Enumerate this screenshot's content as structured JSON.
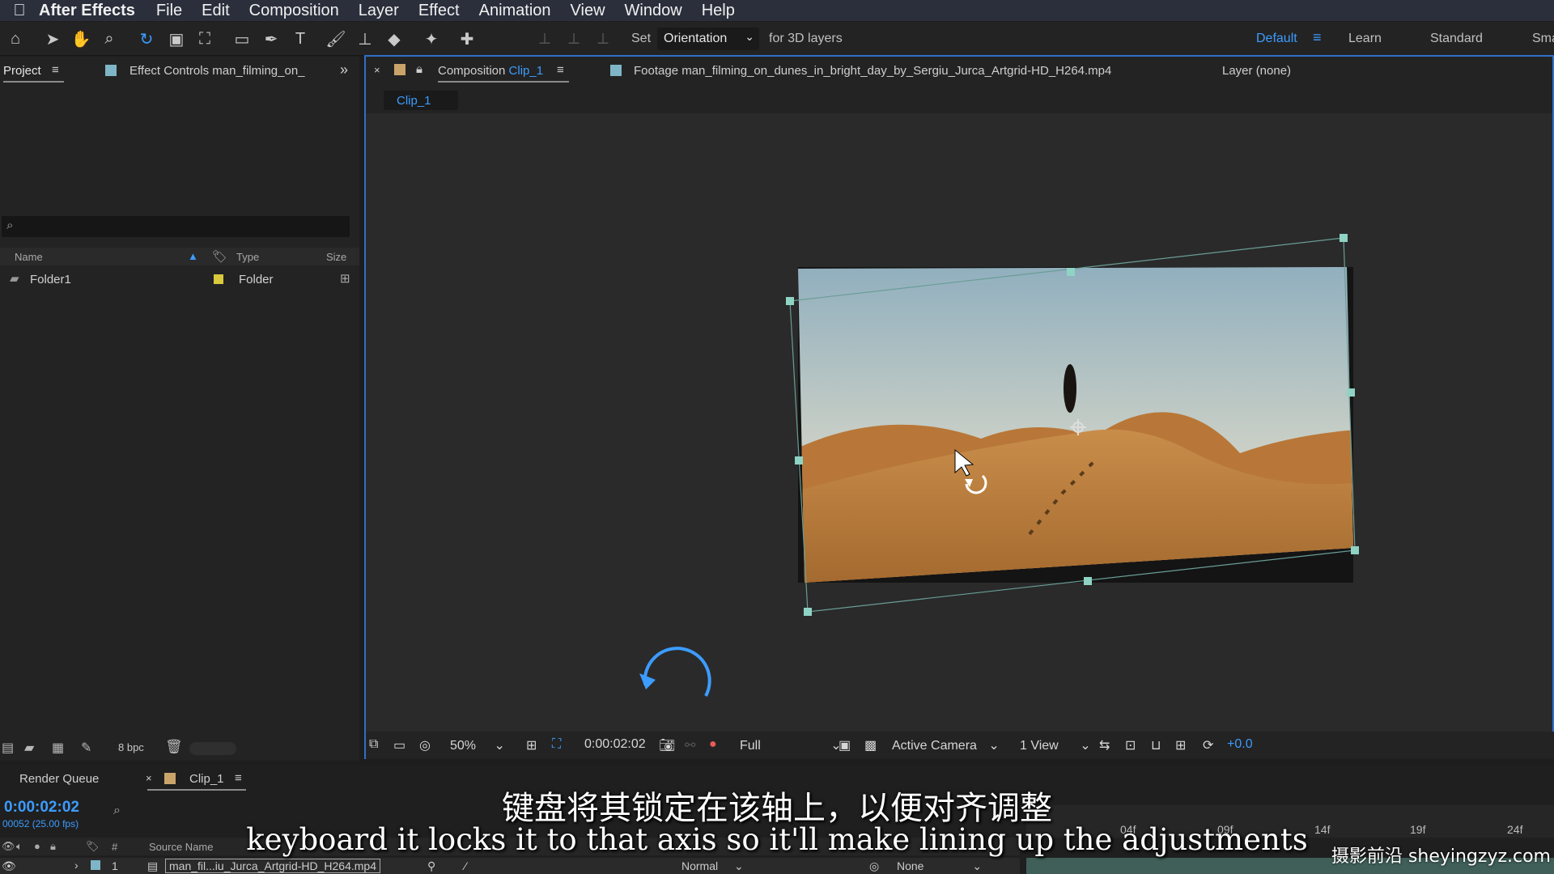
{
  "menubar": {
    "app_name": "After Effects",
    "items": [
      "File",
      "Edit",
      "Composition",
      "Layer",
      "Effect",
      "Animation",
      "View",
      "Window",
      "Help"
    ]
  },
  "toolbar": {
    "set_label": "Set",
    "orientation_value": "Orientation",
    "for_3d_label": "for 3D layers",
    "workspaces": {
      "default": "Default",
      "learn": "Learn",
      "standard": "Standard",
      "small": "Sma"
    }
  },
  "project_panel": {
    "tab_project": "Project",
    "tab_effect_controls": "Effect Controls man_filming_on_",
    "columns": {
      "name": "Name",
      "type": "Type",
      "size": "Size"
    },
    "rows": [
      {
        "name": "Folder1",
        "type": "Folder"
      }
    ],
    "bpc": "8 bpc"
  },
  "viewer": {
    "tab_composition_prefix": "Composition",
    "tab_composition_name": "Clip_1",
    "tab_footage": "Footage man_filming_on_dunes_in_bright_day_by_Sergiu_Jurca_Artgrid-HD_H264.mp4",
    "tab_layer": "Layer (none)",
    "comp_subtab": "Clip_1",
    "zoom": "50%",
    "timecode": "0:00:02:02",
    "resolution": "Full",
    "camera": "Active Camera",
    "views": "1 View",
    "exposure": "+0.0"
  },
  "timeline": {
    "render_queue": "Render Queue",
    "comp_tab": "Clip_1",
    "current_time": "0:00:02:02",
    "frame_info": "00052 (25.00 fps)",
    "col_source_name": "Source Name",
    "col_hash": "#",
    "ruler": [
      "04f",
      "09f",
      "14f",
      "19f",
      "24f"
    ],
    "layer": {
      "index": "1",
      "name": "man_fil...iu_Jurca_Artgrid-HD_H264.mp4",
      "mode": "Normal",
      "parent": "None"
    }
  },
  "subtitles": {
    "zh": "键盘将其锁定在该轴上，以便对齐调整",
    "en": "keyboard it locks it to that axis so it'll make lining up the adjustments"
  },
  "watermark": "摄影前沿 sheyingzyz.com",
  "colors": {
    "accent": "#3c9cff",
    "handle": "#8fd3c4",
    "label_yellow": "#d9c93d",
    "label_tan": "#c9a46a"
  }
}
